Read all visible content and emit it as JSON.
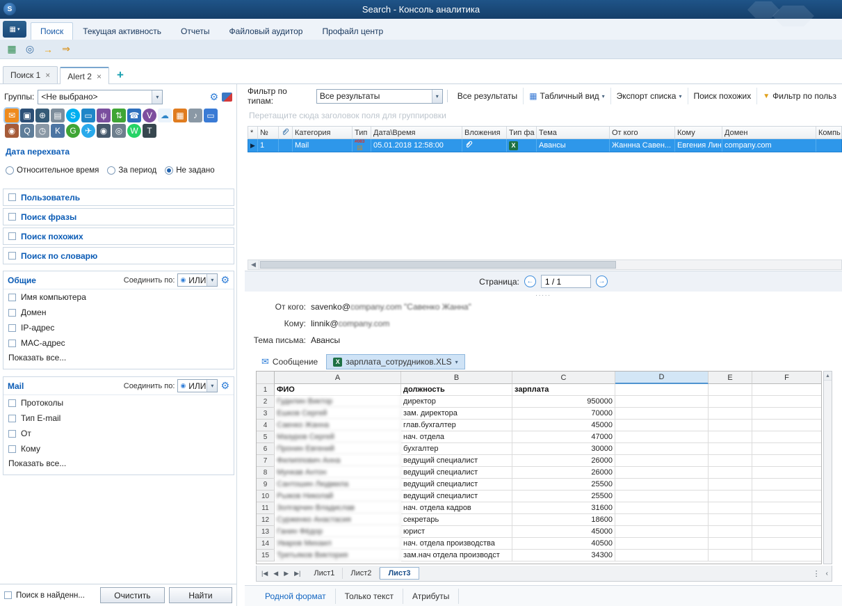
{
  "window": {
    "title": "Search - Консоль аналитика",
    "watermark": "SEA"
  },
  "menu": {
    "tabs": [
      {
        "label": "Поиск",
        "active": true
      },
      {
        "label": "Текущая активность",
        "active": false
      },
      {
        "label": "Отчеты",
        "active": false
      },
      {
        "label": "Файловый аудитор",
        "active": false
      },
      {
        "label": "Профайл центр",
        "active": false
      }
    ]
  },
  "quick_toolbar": [
    {
      "name": "new-search-tab-icon",
      "glyph": "▦",
      "fg": "#2e8b50"
    },
    {
      "name": "search-settings-icon",
      "glyph": "◎",
      "fg": "#3a6ea5"
    },
    {
      "name": "load-query-icon",
      "glyph": "→",
      "fg": "#e8a013"
    },
    {
      "name": "save-query-icon",
      "glyph": "⇒",
      "fg": "#d88a0a"
    }
  ],
  "doc_tabs": {
    "tabs": [
      {
        "label": "Поиск 1",
        "active": false
      },
      {
        "label": "Alert 2",
        "active": true
      }
    ],
    "close_glyph": "×",
    "add_glyph": "+"
  },
  "sidebar": {
    "groups": {
      "label": "Группы:",
      "value": "<Не выбрано>"
    },
    "channels_row1": [
      {
        "name": "mail-channel-icon",
        "glyph": "✉",
        "bg": "#ef8b1d",
        "selected": true
      },
      {
        "name": "im-channel-icon",
        "glyph": "▣",
        "bg": "#2c4f76"
      },
      {
        "name": "http-channel-icon",
        "glyph": "⊕",
        "bg": "#355a77"
      },
      {
        "name": "printer-channel-icon",
        "glyph": "▤",
        "bg": "#7d8d9b"
      },
      {
        "name": "skype-channel-icon",
        "glyph": "S",
        "bg": "#00aff0",
        "round": true
      },
      {
        "name": "monitoring-channel-icon",
        "glyph": "▭",
        "bg": "#1f86c8"
      },
      {
        "name": "usb-device-channel-icon",
        "glyph": "ψ",
        "bg": "#7a4f9e"
      },
      {
        "name": "ftp-channel-icon",
        "glyph": "⇅",
        "bg": "#3fa535"
      },
      {
        "name": "ip-telephony-channel-icon",
        "glyph": "☎",
        "bg": "#2d6fbd"
      },
      {
        "name": "viber-channel-icon",
        "glyph": "V",
        "bg": "#7d4e9e",
        "round": true
      },
      {
        "name": "cloud-channel-icon",
        "glyph": "☁",
        "bg": "#eaf3fb",
        "fg": "#2f86c8"
      },
      {
        "name": "sharepoint-channel-icon",
        "glyph": "▦",
        "bg": "#e07c1f"
      },
      {
        "name": "microphone-channel-icon",
        "glyph": "♪",
        "bg": "#8a98a5"
      },
      {
        "name": "desktop-channel-icon",
        "glyph": "▭",
        "bg": "#3a7bd5"
      }
    ],
    "channels_row2": [
      {
        "name": "contacts-channel-icon",
        "glyph": "◉",
        "bg": "#a65b38"
      },
      {
        "name": "person-search-channel-icon",
        "glyph": "Q",
        "bg": "#5e7d99"
      },
      {
        "name": "time-channel-icon",
        "glyph": "◷",
        "bg": "#8a98a5"
      },
      {
        "name": "vk-channel-icon",
        "glyph": "K",
        "bg": "#4c75a3"
      },
      {
        "name": "google-channel-icon",
        "glyph": "G",
        "bg": "#3fa535",
        "round": true
      },
      {
        "name": "telegram-channel-icon",
        "glyph": "✈",
        "bg": "#29a9eb",
        "round": true
      },
      {
        "name": "camera-channel-icon",
        "glyph": "◉",
        "bg": "#44586b"
      },
      {
        "name": "webcam-channel-icon",
        "glyph": "◎",
        "bg": "#6e7f8d"
      },
      {
        "name": "whatsapp-channel-icon",
        "glyph": "W",
        "bg": "#25d366",
        "round": true
      },
      {
        "name": "keylogger-channel-icon",
        "glyph": "T",
        "bg": "#37474f"
      }
    ],
    "date_filter": {
      "title": "Дата перехвата",
      "options": [
        {
          "label": "Относительное время",
          "selected": false
        },
        {
          "label": "За период",
          "selected": false
        },
        {
          "label": "Не задано",
          "selected": true
        }
      ]
    },
    "search_sections": [
      "Пользователь",
      "Поиск фразы",
      "Поиск похожих",
      "Поиск по словарю"
    ],
    "common_section": {
      "title": "Общие",
      "join_label": "Соединить по:",
      "join_value": "ИЛИ",
      "items": [
        "Имя компьютера",
        "Домен",
        "IP-адрес",
        "MAC-адрес"
      ],
      "show_all": "Показать все..."
    },
    "mail_section": {
      "title": "Mail",
      "join_label": "Соединить по:",
      "join_value": "ИЛИ",
      "items": [
        "Протоколы",
        "Тип E-mail",
        "От",
        "Кому"
      ],
      "show_all": "Показать все..."
    },
    "footer": {
      "search_in_found": "Поиск в найденн...",
      "clear": "Очистить",
      "find": "Найти"
    }
  },
  "results": {
    "filter": {
      "label": "Фильтр по типам:",
      "value": "Все результаты"
    },
    "buttons": [
      {
        "label": "Все результаты"
      },
      {
        "label": "Табличный вид",
        "icon": "grid",
        "dropdown": true
      },
      {
        "label": "Экспорт списка",
        "dropdown": true
      },
      {
        "label": "Поиск похожих"
      },
      {
        "label": "Фильтр по польз",
        "icon": "funnel"
      }
    ],
    "group_hint": "Перетащите сюда заголовок поля для группировки",
    "columns": [
      {
        "label": "*"
      },
      {
        "label": "№"
      },
      {
        "icon": "paperclip"
      },
      {
        "label": "Категория"
      },
      {
        "label": "Тип"
      },
      {
        "label": "Дата\\Время"
      },
      {
        "label": "Вложения"
      },
      {
        "label": "Тип фа"
      },
      {
        "label": "Тема"
      },
      {
        "label": "От кого"
      },
      {
        "label": "Кому"
      },
      {
        "label": "Домен"
      },
      {
        "label": "Компь"
      }
    ],
    "row_cells": [
      {
        "icon": "row-marker"
      },
      {
        "text": "1"
      },
      {
        "text": ""
      },
      {
        "text": "Mail"
      },
      {
        "icon": "message-type"
      },
      {
        "text": "05.01.2018 12:58:00"
      },
      {
        "icon": "paperclip-white"
      },
      {
        "icon": "excel-file"
      },
      {
        "text": "Авансы"
      },
      {
        "text": "Жаннна Савен..."
      },
      {
        "text": "Евгения Линн..."
      },
      {
        "text": "company.com"
      },
      {
        "text": ""
      }
    ],
    "type_badge": "#083",
    "page": {
      "label": "Страница:",
      "value": "1 / 1"
    }
  },
  "preview": {
    "from_label": "От кого:",
    "from_plain": "savenko@",
    "from_blurred": "company.com \"Савенко Жанна\"",
    "to_label": "Кому:",
    "to_plain": "linnik@",
    "to_blurred": "company.com",
    "subject_label": "Тема письма:",
    "subject_value": "Авансы",
    "message_tab": "Сообщение",
    "attachment_tab": "зарплата_сотрудников.XLS"
  },
  "spreadsheet": {
    "col_headers": [
      "A",
      "B",
      "C",
      "D",
      "E",
      "F"
    ],
    "selected_col": "D",
    "names_blurred": true,
    "rows": [
      {
        "n": "1",
        "a": "ФИО",
        "b": "должность",
        "c": "зарплата",
        "header": true
      },
      {
        "n": "2",
        "a": "Гудилин Виктор",
        "b": "директор",
        "c": "950000"
      },
      {
        "n": "3",
        "a": "Ешков Сергей",
        "b": "зам. директора",
        "c": "70000"
      },
      {
        "n": "4",
        "a": "Саенко Жанна",
        "b": "глав.бухгалтер",
        "c": "45000"
      },
      {
        "n": "5",
        "a": "Мазуров Сергей",
        "b": "нач. отдела",
        "c": "47000"
      },
      {
        "n": "6",
        "a": "Пронин Евгений",
        "b": "бухгалтер",
        "c": "30000"
      },
      {
        "n": "7",
        "a": "Филиппович Анна",
        "b": "ведущий специалист",
        "c": "26000"
      },
      {
        "n": "8",
        "a": "Мункав Антон",
        "b": "ведущий специалист",
        "c": "26000"
      },
      {
        "n": "9",
        "a": "Сантошин Людмила",
        "b": "ведущий специалист",
        "c": "25500"
      },
      {
        "n": "10",
        "a": "Рыжов Николай",
        "b": "ведущий специалист",
        "c": "25500"
      },
      {
        "n": "11",
        "a": "Золгарчин Владислав",
        "b": "нач. отдела кадров",
        "c": "31600"
      },
      {
        "n": "12",
        "a": "Сурженко Анастасия",
        "b": "секретарь",
        "c": "18600"
      },
      {
        "n": "13",
        "a": "Ганин Фёдор",
        "b": "юрист",
        "c": "45000"
      },
      {
        "n": "14",
        "a": "Уваров Михаил",
        "b": "нач. отдела производства",
        "c": "40500"
      },
      {
        "n": "15",
        "a": "Третьяков Виктория",
        "b": "зам.нач отдела производст",
        "c": "34300"
      }
    ],
    "sheet_tabs": [
      {
        "label": "Лист1",
        "active": false
      },
      {
        "label": "Лист2",
        "active": false
      },
      {
        "label": "Лист3",
        "active": true
      }
    ]
  },
  "bottom_tabs": {
    "tabs": [
      "Родной формат",
      "Только текст",
      "Атрибуты"
    ],
    "active": 0
  }
}
